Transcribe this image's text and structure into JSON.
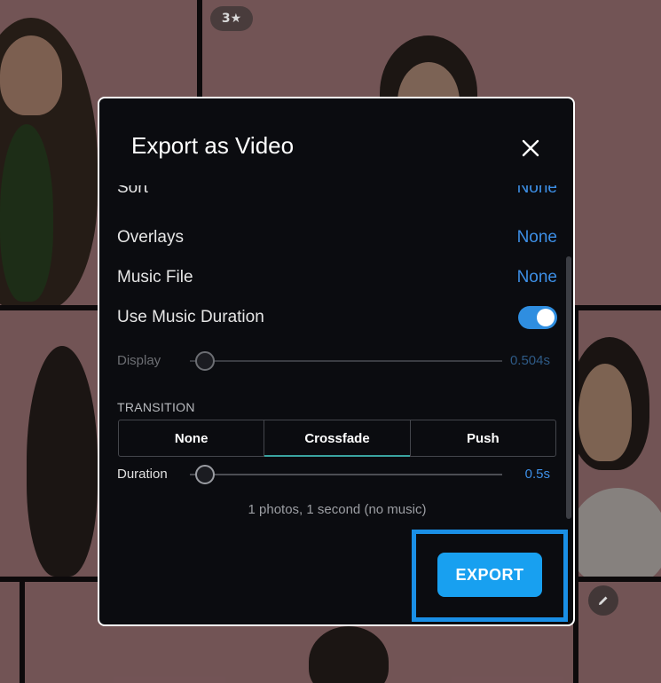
{
  "background": {
    "rating_badge": "3★",
    "edit_icon": "pencil-icon"
  },
  "dialog": {
    "title": "Export as Video",
    "close_icon": "close-icon",
    "rows": {
      "sort": {
        "label": "Sort",
        "value": "None"
      },
      "overlays": {
        "label": "Overlays",
        "value": "None"
      },
      "music_file": {
        "label": "Music File",
        "value": "None"
      },
      "use_music_duration": {
        "label": "Use Music Duration",
        "enabled": true
      }
    },
    "display": {
      "label": "Display",
      "value": "0.504s",
      "level": 0.0
    },
    "transition": {
      "section_label": "TRANSITION",
      "options": [
        "None",
        "Crossfade",
        "Push"
      ],
      "selected": "Crossfade"
    },
    "duration": {
      "label": "Duration",
      "value": "0.5s",
      "level": 0.0
    },
    "summary": "1 photos, 1 second (no music)",
    "export_label": "EXPORT"
  },
  "colors": {
    "accent": "#3d8fe6",
    "export_button": "#18a0f0",
    "highlight_border": "#1a8fe6",
    "dialog_bg": "#0b0c10"
  }
}
